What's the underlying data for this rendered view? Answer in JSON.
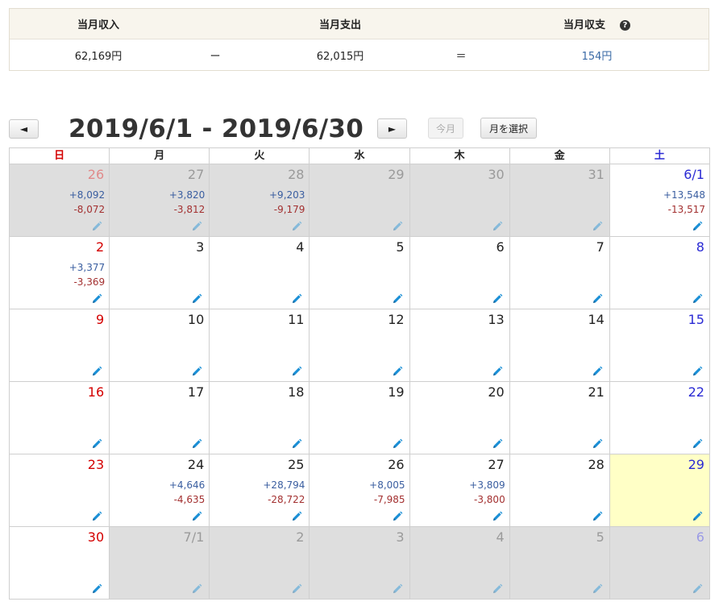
{
  "summary": {
    "income_label": "当月収入",
    "expense_label": "当月支出",
    "balance_label": "当月収支",
    "income_value": "62,169円",
    "minus_sign": "ー",
    "expense_value": "62,015円",
    "equals_sign": "＝",
    "balance_value": "154円",
    "help_icon": "question-circle-icon"
  },
  "toolbar": {
    "prev_label": "◄",
    "next_label": "►",
    "range_title": "2019/6/1 - 2019/6/30",
    "today_label": "今月",
    "select_month_label": "月を選択"
  },
  "weekdays": [
    "日",
    "月",
    "火",
    "水",
    "木",
    "金",
    "土"
  ],
  "weeks": [
    [
      {
        "day": "26",
        "other": true,
        "inc": "+8,092",
        "exp": "-8,072"
      },
      {
        "day": "27",
        "other": true,
        "inc": "+3,820",
        "exp": "-3,812"
      },
      {
        "day": "28",
        "other": true,
        "inc": "+9,203",
        "exp": "-9,179"
      },
      {
        "day": "29",
        "other": true,
        "inc": "",
        "exp": ""
      },
      {
        "day": "30",
        "other": true,
        "inc": "",
        "exp": ""
      },
      {
        "day": "31",
        "other": true,
        "inc": "",
        "exp": ""
      },
      {
        "day": "6/1",
        "other": false,
        "inc": "+13,548",
        "exp": "-13,517"
      }
    ],
    [
      {
        "day": "2",
        "other": false,
        "inc": "+3,377",
        "exp": "-3,369"
      },
      {
        "day": "3",
        "other": false,
        "inc": "",
        "exp": ""
      },
      {
        "day": "4",
        "other": false,
        "inc": "",
        "exp": ""
      },
      {
        "day": "5",
        "other": false,
        "inc": "",
        "exp": ""
      },
      {
        "day": "6",
        "other": false,
        "inc": "",
        "exp": ""
      },
      {
        "day": "7",
        "other": false,
        "inc": "",
        "exp": ""
      },
      {
        "day": "8",
        "other": false,
        "inc": "",
        "exp": ""
      }
    ],
    [
      {
        "day": "9",
        "other": false,
        "inc": "",
        "exp": ""
      },
      {
        "day": "10",
        "other": false,
        "inc": "",
        "exp": ""
      },
      {
        "day": "11",
        "other": false,
        "inc": "",
        "exp": ""
      },
      {
        "day": "12",
        "other": false,
        "inc": "",
        "exp": ""
      },
      {
        "day": "13",
        "other": false,
        "inc": "",
        "exp": ""
      },
      {
        "day": "14",
        "other": false,
        "inc": "",
        "exp": ""
      },
      {
        "day": "15",
        "other": false,
        "inc": "",
        "exp": ""
      }
    ],
    [
      {
        "day": "16",
        "other": false,
        "inc": "",
        "exp": ""
      },
      {
        "day": "17",
        "other": false,
        "inc": "",
        "exp": ""
      },
      {
        "day": "18",
        "other": false,
        "inc": "",
        "exp": ""
      },
      {
        "day": "19",
        "other": false,
        "inc": "",
        "exp": ""
      },
      {
        "day": "20",
        "other": false,
        "inc": "",
        "exp": ""
      },
      {
        "day": "21",
        "other": false,
        "inc": "",
        "exp": ""
      },
      {
        "day": "22",
        "other": false,
        "inc": "",
        "exp": ""
      }
    ],
    [
      {
        "day": "23",
        "other": false,
        "inc": "",
        "exp": ""
      },
      {
        "day": "24",
        "other": false,
        "inc": "+4,646",
        "exp": "-4,635"
      },
      {
        "day": "25",
        "other": false,
        "inc": "+28,794",
        "exp": "-28,722"
      },
      {
        "day": "26",
        "other": false,
        "inc": "+8,005",
        "exp": "-7,985"
      },
      {
        "day": "27",
        "other": false,
        "inc": "+3,809",
        "exp": "-3,800"
      },
      {
        "day": "28",
        "other": false,
        "inc": "",
        "exp": ""
      },
      {
        "day": "29",
        "other": false,
        "today": true,
        "inc": "",
        "exp": ""
      }
    ],
    [
      {
        "day": "30",
        "other": false,
        "inc": "",
        "exp": ""
      },
      {
        "day": "7/1",
        "other": true,
        "inc": "",
        "exp": ""
      },
      {
        "day": "2",
        "other": true,
        "inc": "",
        "exp": ""
      },
      {
        "day": "3",
        "other": true,
        "inc": "",
        "exp": ""
      },
      {
        "day": "4",
        "other": true,
        "inc": "",
        "exp": ""
      },
      {
        "day": "5",
        "other": true,
        "inc": "",
        "exp": ""
      },
      {
        "day": "6",
        "other": true,
        "inc": "",
        "exp": ""
      }
    ]
  ],
  "colors": {
    "sunday": "#d40000",
    "saturday": "#2a2ad4",
    "income": "#3a5ea0",
    "expense": "#a33030",
    "today_bg": "#ffffc6",
    "other_month_bg": "#dedede",
    "pencil": "#1a8fd6"
  },
  "cell_icon": "pencil-icon"
}
